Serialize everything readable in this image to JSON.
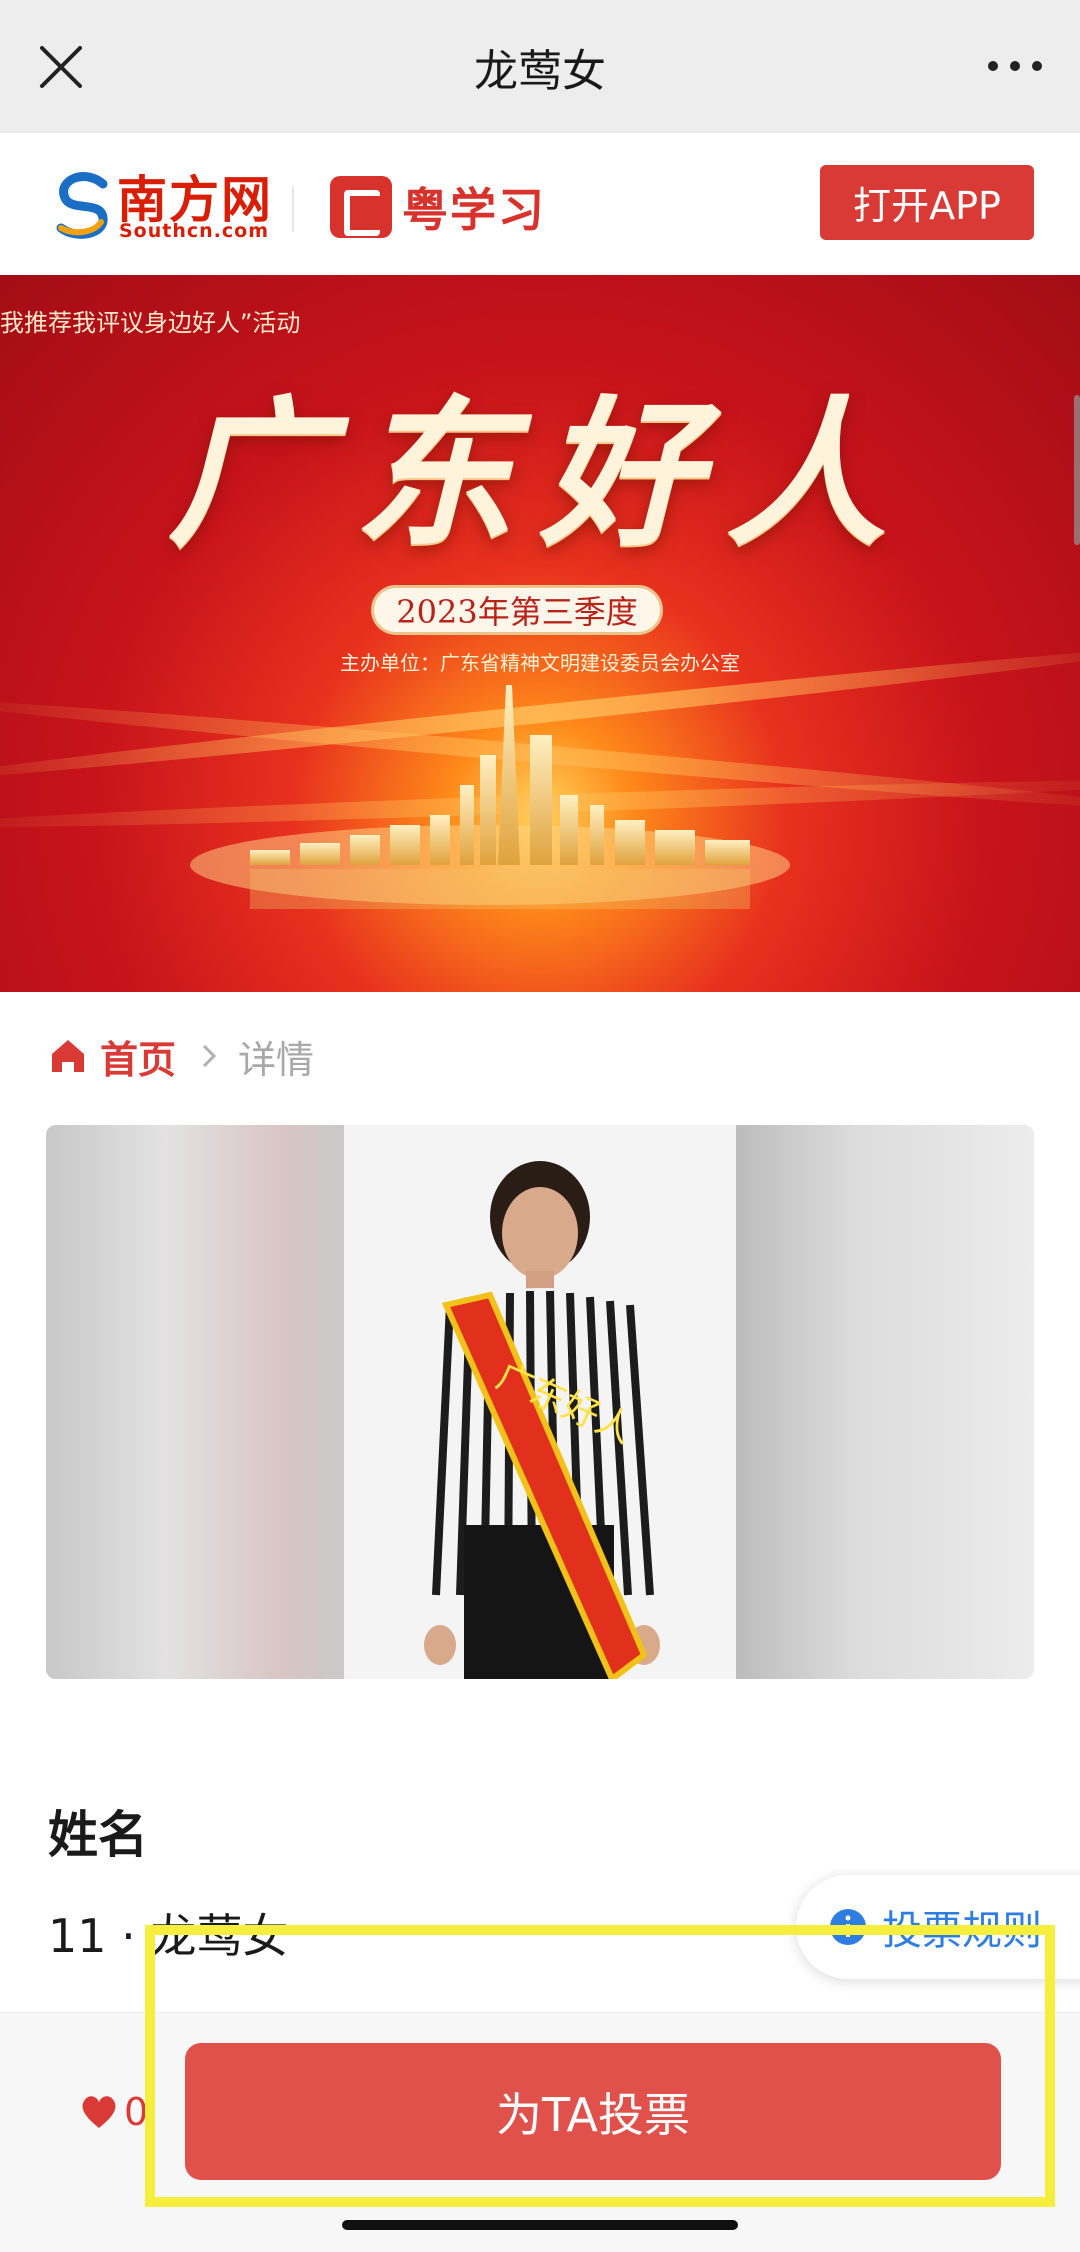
{
  "nav": {
    "title": "龙莺女"
  },
  "brand": {
    "south_cn": "南方网",
    "south_en": "Southcn.com",
    "yue_name": "粤学习",
    "open_app": "打开APP"
  },
  "banner": {
    "topline": "我推荐我评议身边好人”活动",
    "title": "广东好人",
    "season": "2023年第三季度",
    "organizer": "主办单位：广东省精神文明建设委员会办公室",
    "sash_text": "广东好人"
  },
  "breadcrumb": {
    "home": "首页",
    "current": "详情"
  },
  "profile": {
    "section_label": "姓名",
    "candidate": "11 · 龙莺女"
  },
  "vote_rules": {
    "label": "投票规则"
  },
  "bottom": {
    "like_count": "0",
    "vote_button": "为TA投票"
  },
  "colors": {
    "accent": "#d93a35",
    "vote_button": "#e0514b",
    "highlight": "#f5ee3c",
    "link_blue": "#2d7ee0"
  },
  "icons": [
    "close-icon",
    "more-icon",
    "home-icon",
    "chevron-right-icon",
    "info-icon",
    "heart-icon"
  ]
}
